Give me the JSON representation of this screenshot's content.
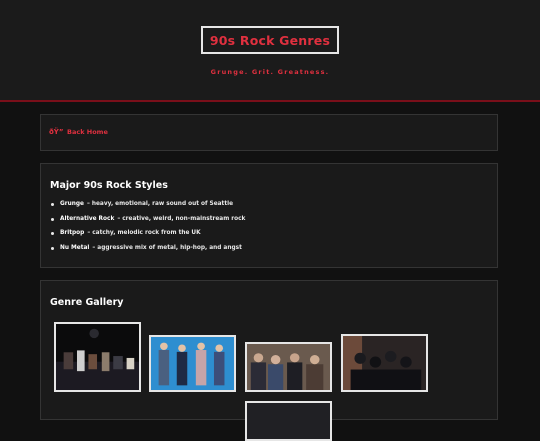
{
  "header": {
    "title": "90s Rock Genres",
    "tagline": "Grunge. Grit. Greatness."
  },
  "nav": {
    "back_icon": "ðŸ”",
    "back_label": "Back Home"
  },
  "styles": {
    "heading": "Major 90s Rock Styles",
    "items": [
      {
        "name": "Grunge",
        "desc": "– heavy, emotional, raw sound out of Seattle"
      },
      {
        "name": "Alternative Rock",
        "desc": "– creative, weird, non-mainstream rock"
      },
      {
        "name": "Britpop",
        "desc": "– catchy, melodic rock from the UK"
      },
      {
        "name": "Nu Metal",
        "desc": "– aggressive mix of metal, hip-hop, and angst"
      }
    ]
  },
  "gallery": {
    "heading": "Genre Gallery"
  },
  "colors": {
    "accent": "#e0303f",
    "background": "#111111",
    "card": "#1a1a1a",
    "divider": "#7a0f1a"
  }
}
